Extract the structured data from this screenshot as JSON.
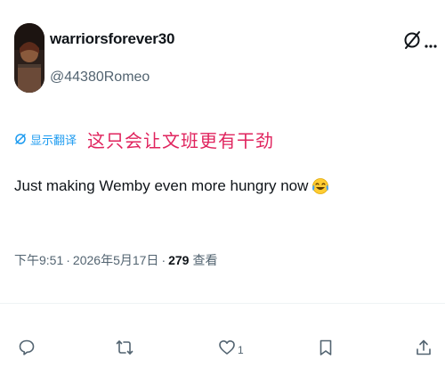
{
  "post": {
    "author": {
      "display_name": "warriorsforever30",
      "handle": "@44380Romeo"
    },
    "translate": {
      "label": "显示翻译",
      "translated_text": "这只会让文班更有干劲"
    },
    "text": "Just making Wemby even more hungry now",
    "emoji": "face-with-tears-of-joy",
    "meta": {
      "time": "下午9:51",
      "separator": "·",
      "date": "2026年5月17日",
      "separator2": "·",
      "views_count": "279",
      "views_label": "查看"
    },
    "actions": {
      "reply_count": "",
      "repost_count": "",
      "like_count": "1",
      "bookmark_count": "",
      "share_count": ""
    }
  },
  "icons": {
    "top_right": [
      "grok-icon",
      "more-icon"
    ],
    "actions": [
      "reply-icon",
      "repost-icon",
      "like-icon",
      "bookmark-icon",
      "share-icon"
    ]
  },
  "colors": {
    "text_primary": "#0f1419",
    "text_secondary": "#536471",
    "link_blue": "#1d9bf0",
    "translated_red": "#e0245e"
  }
}
